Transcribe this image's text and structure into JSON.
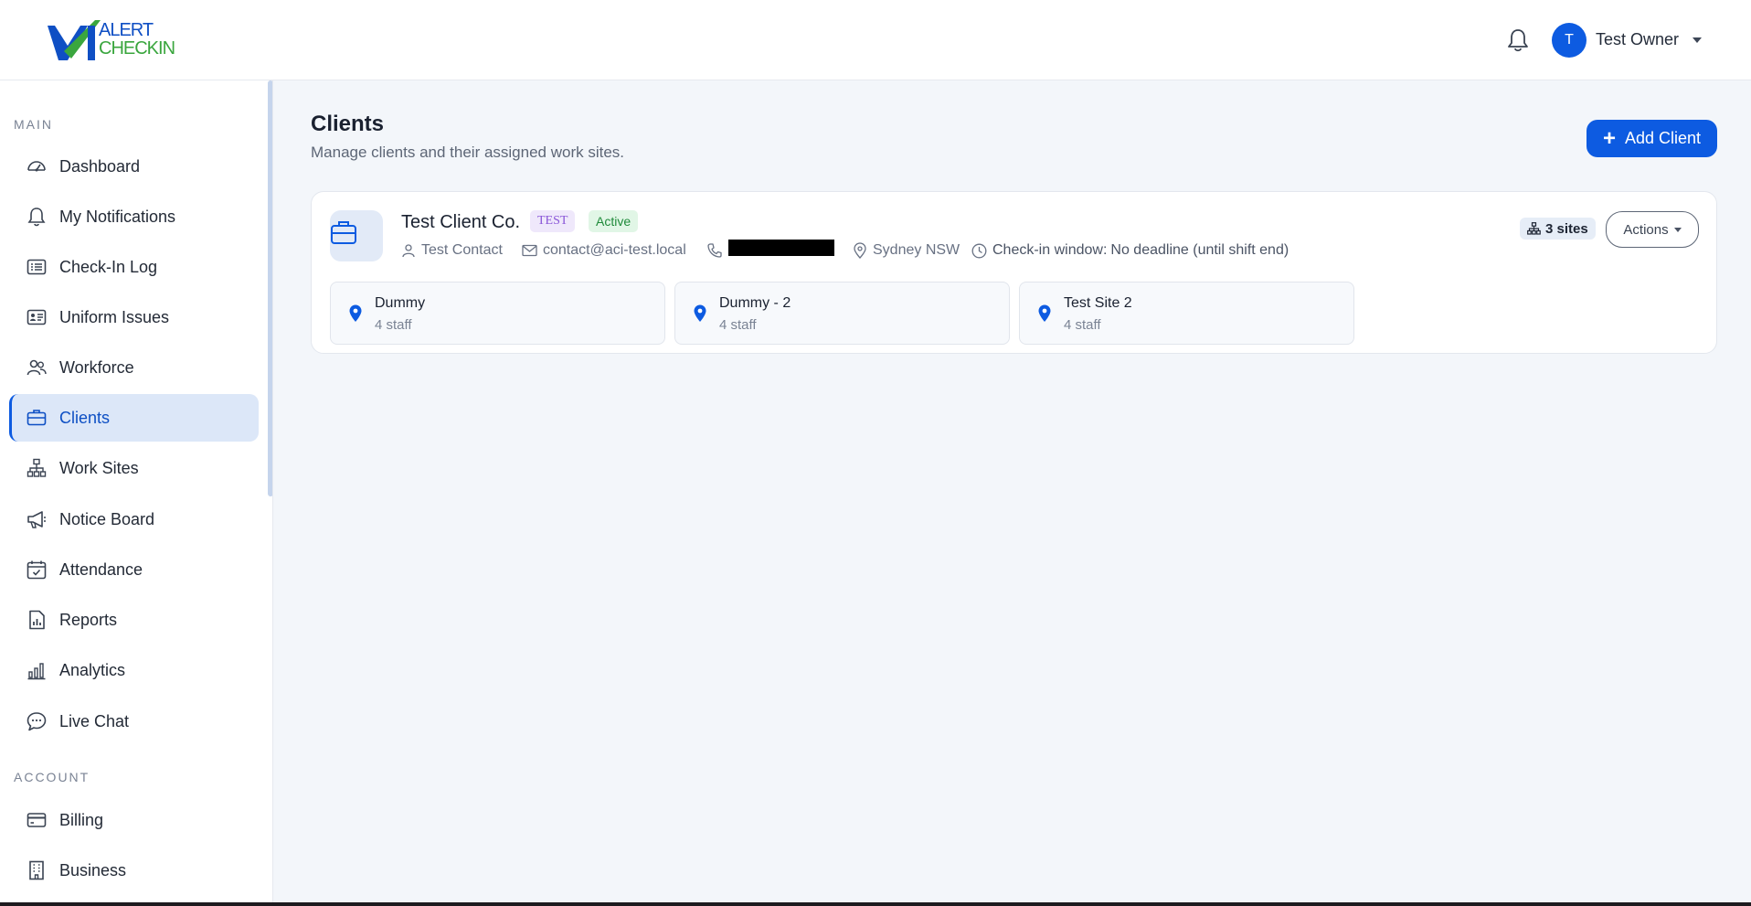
{
  "brand": {
    "line1": "ALERT",
    "line2": "CHECKIN",
    "blue": "#0f4fc4",
    "green": "#3aa63e"
  },
  "header": {
    "notifications_icon": "bell-icon",
    "user_initial": "T",
    "user_name": "Test Owner"
  },
  "sidebar": {
    "main_label": "MAIN",
    "account_label": "ACCOUNT",
    "items": [
      {
        "label": "Dashboard",
        "icon": "speedometer-icon"
      },
      {
        "label": "My Notifications",
        "icon": "bell-icon"
      },
      {
        "label": "Check-In Log",
        "icon": "list-card-icon"
      },
      {
        "label": "Uniform Issues",
        "icon": "id-card-icon"
      },
      {
        "label": "Workforce",
        "icon": "people-icon"
      },
      {
        "label": "Clients",
        "icon": "briefcase-icon",
        "active": true
      },
      {
        "label": "Work Sites",
        "icon": "sitemap-icon"
      },
      {
        "label": "Notice Board",
        "icon": "megaphone-icon"
      },
      {
        "label": "Attendance",
        "icon": "calendar-check-icon"
      },
      {
        "label": "Reports",
        "icon": "report-icon"
      },
      {
        "label": "Analytics",
        "icon": "bar-chart-icon"
      },
      {
        "label": "Live Chat",
        "icon": "chat-icon"
      }
    ],
    "account_items": [
      {
        "label": "Billing",
        "icon": "credit-card-icon"
      },
      {
        "label": "Business",
        "icon": "building-icon"
      }
    ]
  },
  "page": {
    "title": "Clients",
    "subtitle": "Manage clients and their assigned work sites.",
    "add_button": "Add Client"
  },
  "client": {
    "name": "Test Client Co.",
    "tag": "TEST",
    "status": "Active",
    "contact": "Test Contact",
    "email": "contact@aci-test.local",
    "location": "Sydney NSW",
    "checkin_label": "Check-in window:",
    "checkin_value": "No deadline (until shift end)",
    "sites_count": "3 sites",
    "actions_label": "Actions",
    "sites": [
      {
        "name": "Dummy",
        "staff": "4 staff"
      },
      {
        "name": "Dummy - 2",
        "staff": "4 staff"
      },
      {
        "name": "Test Site 2",
        "staff": "4 staff"
      }
    ]
  },
  "colors": {
    "accent": "#0d5be1",
    "active_bg": "#dce7f8",
    "page_bg": "#f3f6fa"
  }
}
